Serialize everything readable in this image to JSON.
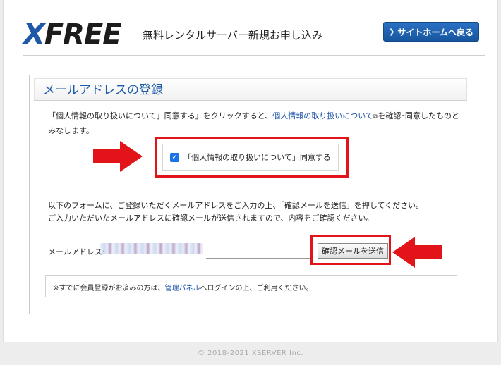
{
  "header": {
    "logo_x": "X",
    "logo_rest": "FREE",
    "tagline": "無料レンタルサーバー新規お申し込み",
    "home_button": "サイトホームへ戻る",
    "home_chevron": "❯"
  },
  "panel": {
    "title": "メールアドレスの登録",
    "intro_a": "「個人情報の取り扱いについて」同意する」をクリックすると、",
    "intro_link": "個人情報の取り扱いについて",
    "intro_b": "を確認･同意したものとみなします。",
    "agree_label": "「個人情報の取り扱いについて」同意する",
    "agree_checked": true,
    "form_desc_1": "以下のフォームに、ご登録いただくメールアドレスをご入力の上、「確認メールを送信」を押してください。",
    "form_desc_2": "ご入力いただいたメールアドレスに確認メールが送信されますので、内容をご確認ください。",
    "email_label": "メールアドレス:",
    "email_value": "",
    "send_button": "確認メールを送信",
    "note_a": "※すでに会員登録がお済みの方は、",
    "note_link": "管理パネル",
    "note_b": "へログインの上、ご利用ください。"
  },
  "footer": {
    "copyright": "© 2018-2021 XSERVER Inc."
  },
  "colors": {
    "brand_blue": "#1e58a6",
    "highlight_red": "#e2141a"
  }
}
